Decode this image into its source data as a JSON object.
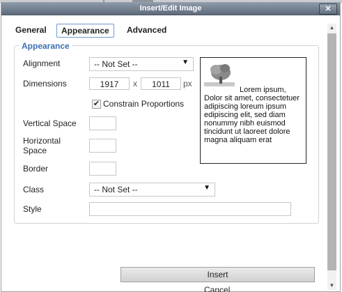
{
  "dialog": {
    "title": "Insert/Edit Image",
    "close_icon": "close-icon"
  },
  "tabs": [
    {
      "label": "General",
      "active": false
    },
    {
      "label": "Appearance",
      "active": true
    },
    {
      "label": "Advanced",
      "active": false
    }
  ],
  "appearance": {
    "legend": "Appearance",
    "alignment_label": "Alignment",
    "alignment_value": "-- Not Set --",
    "dimensions_label": "Dimensions",
    "width_value": "1917",
    "times_sep": "x",
    "height_value": "1011",
    "unit": "px",
    "constrain_label": "Constrain Proportions",
    "constrain_checked": true,
    "vspace_label": "Vertical Space",
    "vspace_value": "",
    "hspace_label_line1": "Horizontal",
    "hspace_label_line2": "Space",
    "hspace_value": "",
    "border_label": "Border",
    "border_value": "",
    "class_label": "Class",
    "class_value": "-- Not Set --",
    "style_label": "Style",
    "style_value": ""
  },
  "preview": {
    "icon": "tree-icon",
    "text": "Lorem ipsum, Dolor sit amet, consectetuer adipiscing loreum ipsum edipiscing elit, sed diam nonummy nibh euismod tincidunt ut laoreet dolore magna aliquam erat"
  },
  "buttons": {
    "insert": "Insert",
    "cancel": "Cancel"
  },
  "colors": {
    "titlebar": "#6f7b8b",
    "accent": "#3a6fb0",
    "tab_border": "#6d9ad1"
  }
}
